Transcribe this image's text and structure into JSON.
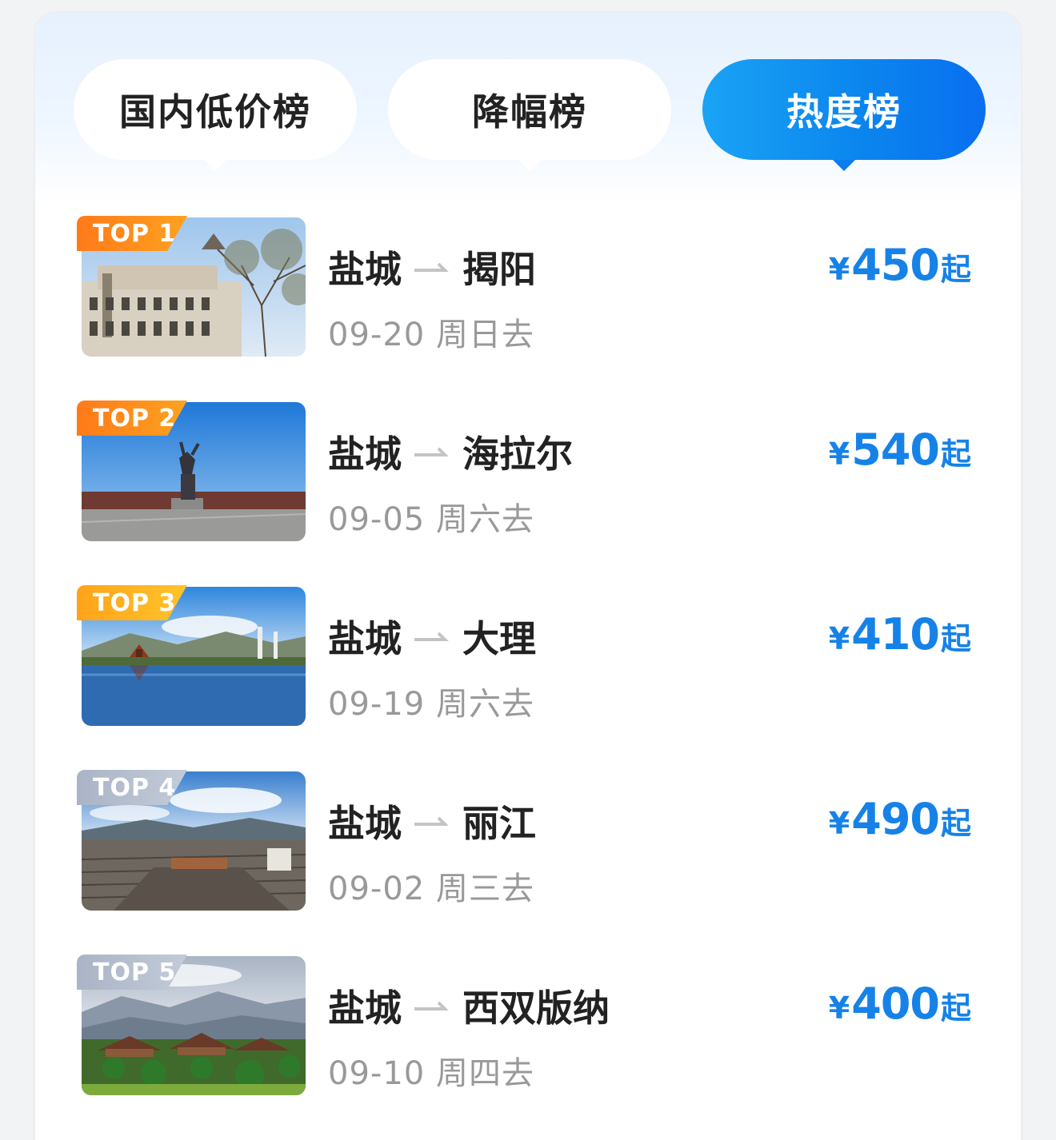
{
  "tabs": [
    {
      "label": "国内低价榜",
      "active": false
    },
    {
      "label": "降幅榜",
      "active": false
    },
    {
      "label": "热度榜",
      "active": true
    }
  ],
  "colors": {
    "accent": "#0b86ee",
    "price": "#1682e8",
    "muted": "#999999"
  },
  "items": [
    {
      "rank": "TOP 1",
      "from": "盐城",
      "to": "揭阳",
      "date": "09-20 周日去",
      "currency": "¥",
      "price": "450",
      "suffix": "起",
      "image": "colonial-building-photo"
    },
    {
      "rank": "TOP 2",
      "from": "盐城",
      "to": "海拉尔",
      "date": "09-05 周六去",
      "currency": "¥",
      "price": "540",
      "suffix": "起",
      "image": "statue-plaza-photo"
    },
    {
      "rank": "TOP 3",
      "from": "盐城",
      "to": "大理",
      "date": "09-19 周六去",
      "currency": "¥",
      "price": "410",
      "suffix": "起",
      "image": "lake-pagoda-photo"
    },
    {
      "rank": "TOP 4",
      "from": "盐城",
      "to": "丽江",
      "date": "09-02 周三去",
      "currency": "¥",
      "price": "490",
      "suffix": "起",
      "image": "old-town-roofs-photo"
    },
    {
      "rank": "TOP 5",
      "from": "盐城",
      "to": "西双版纳",
      "date": "09-10 周四去",
      "currency": "¥",
      "price": "400",
      "suffix": "起",
      "image": "tropical-village-photo"
    }
  ]
}
